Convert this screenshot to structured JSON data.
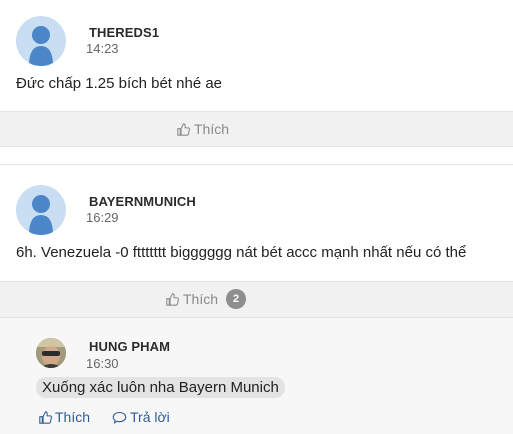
{
  "comments": [
    {
      "username": "THEREDS1",
      "time": "14:23",
      "text": "Đức chấp 1.25 bích bét nhé ae",
      "like_label": "Thích"
    },
    {
      "username": "BAYERNMUNICH",
      "time": "16:29",
      "text": "6h. Venezuela -0 fttttttt bigggggg nát bét accc mạnh nhất nếu có thể",
      "like_label": "Thích",
      "like_count": "2",
      "reply": {
        "username": "HUNG PHAM",
        "time": "16:30",
        "text": "Xuống xác luôn nha Bayern Munich",
        "like_label": "Thích",
        "reply_label": "Trả lời"
      }
    }
  ],
  "colors": {
    "avatar_bg": "#c9def3",
    "avatar_figure": "#4a86c8",
    "action_bar_bg": "#f1f1f1",
    "link_blue": "#2e5c9a"
  }
}
